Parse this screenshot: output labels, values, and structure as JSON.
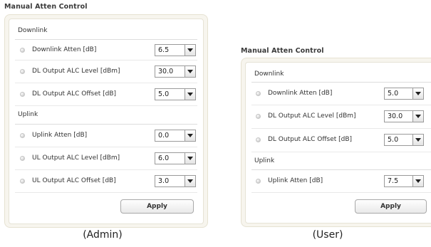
{
  "admin": {
    "title": "Manual Atten Control",
    "downlink_group": "Downlink",
    "uplink_group": "Uplink",
    "fields": [
      {
        "label": "Downlink Atten [dB]",
        "value": "6.5"
      },
      {
        "label": "DL Output ALC Level [dBm]",
        "value": "30.0"
      },
      {
        "label": "DL Output ALC Offset [dB]",
        "value": "5.0"
      },
      {
        "label": "Uplink Atten [dB]",
        "value": "0.0"
      },
      {
        "label": "UL Output ALC Level [dBm]",
        "value": "6.0"
      },
      {
        "label": "UL Output ALC Offset [dB]",
        "value": "3.0"
      }
    ],
    "apply_label": "Apply",
    "caption": "(Admin)"
  },
  "user": {
    "title": "Manual Atten Control",
    "downlink_group": "Downlink",
    "uplink_group": "Uplink",
    "fields": [
      {
        "label": "Downlink Atten [dB]",
        "value": "5.0"
      },
      {
        "label": "DL Output ALC Level [dBm]",
        "value": "30.0"
      },
      {
        "label": "DL Output ALC Offset [dB]",
        "value": "5.0"
      },
      {
        "label": "Uplink Atten [dB]",
        "value": "7.5"
      }
    ],
    "apply_label": "Apply",
    "caption": "(User)"
  }
}
